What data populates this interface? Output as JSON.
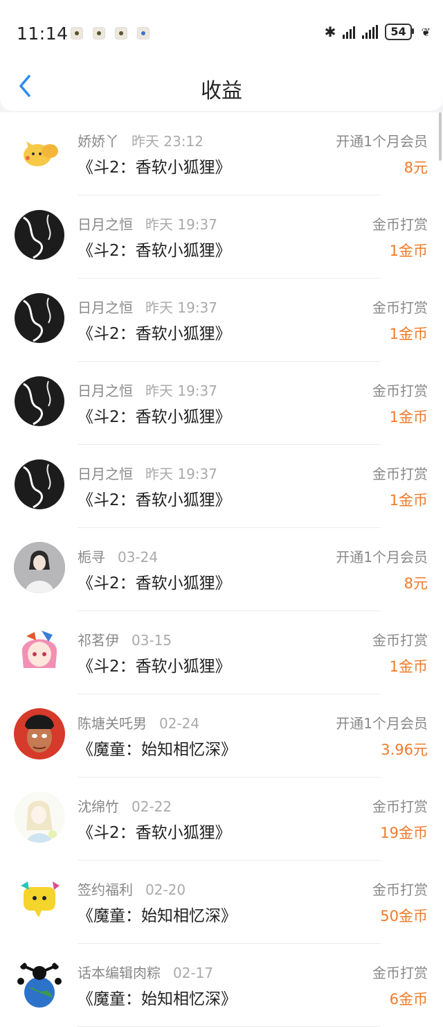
{
  "status": {
    "time": "11:14",
    "battery": "54"
  },
  "nav": {
    "title": "收益"
  },
  "items": [
    {
      "name": "娇娇丫",
      "time": "昨天 23:12",
      "work": "《斗2：香软小狐狸》",
      "type": "开通1个月会员",
      "amount": "8元",
      "avatar": "pikachu-avatar"
    },
    {
      "name": "日月之恒",
      "time": "昨天 19:37",
      "work": "《斗2：香软小狐狸》",
      "type": "金币打赏",
      "amount": "1金币",
      "avatar": "dark-swirl-avatar"
    },
    {
      "name": "日月之恒",
      "time": "昨天 19:37",
      "work": "《斗2：香软小狐狸》",
      "type": "金币打赏",
      "amount": "1金币",
      "avatar": "dark-swirl-avatar"
    },
    {
      "name": "日月之恒",
      "time": "昨天 19:37",
      "work": "《斗2：香软小狐狸》",
      "type": "金币打赏",
      "amount": "1金币",
      "avatar": "dark-swirl-avatar"
    },
    {
      "name": "日月之恒",
      "time": "昨天 19:37",
      "work": "《斗2：香软小狐狸》",
      "type": "金币打赏",
      "amount": "1金币",
      "avatar": "dark-swirl-avatar"
    },
    {
      "name": "栀寻",
      "time": "03-24",
      "work": "《斗2：香软小狐狸》",
      "type": "开通1个月会员",
      "amount": "8元",
      "avatar": "girl-photo-avatar"
    },
    {
      "name": "祁茗伊",
      "time": "03-15",
      "work": "《斗2：香软小狐狸》",
      "type": "金币打赏",
      "amount": "1金币",
      "avatar": "anime-girl-avatar"
    },
    {
      "name": "陈塘关吒男",
      "time": "02-24",
      "work": "《魔童：始知相忆深》",
      "type": "开通1个月会员",
      "amount": "3.96元",
      "avatar": "nezha-avatar"
    },
    {
      "name": "沈绵竹",
      "time": "02-22",
      "work": "《斗2：香软小狐狸》",
      "type": "金币打赏",
      "amount": "19金币",
      "avatar": "sketch-girl-avatar"
    },
    {
      "name": "签约福利",
      "time": "02-20",
      "work": "《魔童：始知相忆深》",
      "type": "金币打赏",
      "amount": "50金币",
      "avatar": "chat-bubble-avatar"
    },
    {
      "name": "话本编辑肉粽",
      "time": "02-17",
      "work": "《魔童：始知相忆深》",
      "type": "金币打赏",
      "amount": "6金币",
      "avatar": "globe-avatar"
    }
  ]
}
